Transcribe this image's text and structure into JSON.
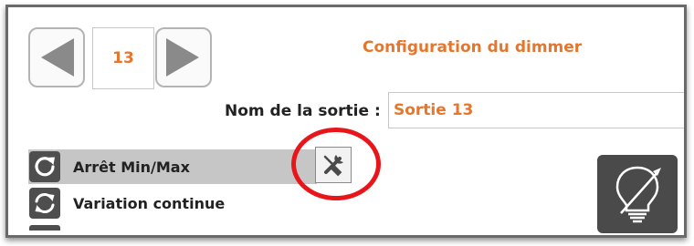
{
  "header": {
    "output_number": "13",
    "title": "Configuration du dimmer"
  },
  "navigation": {
    "prev_icon": "arrow-left-icon",
    "next_icon": "arrow-right-icon"
  },
  "output_name": {
    "label": "Nom de la sortie :",
    "value": "Sortie 13"
  },
  "modes": [
    {
      "label": "Arrêt Min/Max",
      "icon": "refresh-arrow-icon",
      "selected": true
    },
    {
      "label": "Variation continue",
      "icon": "cycle-arrows-icon",
      "selected": false
    }
  ],
  "settings_icon": "wrench-screwdriver-icon",
  "dimmer_icon": "dimmable-bulb-icon",
  "colors": {
    "accent": "#e6762c",
    "highlight": "#e8151b",
    "selected_row": "#c6c6c6",
    "icon_dark": "#4e4e4e"
  }
}
